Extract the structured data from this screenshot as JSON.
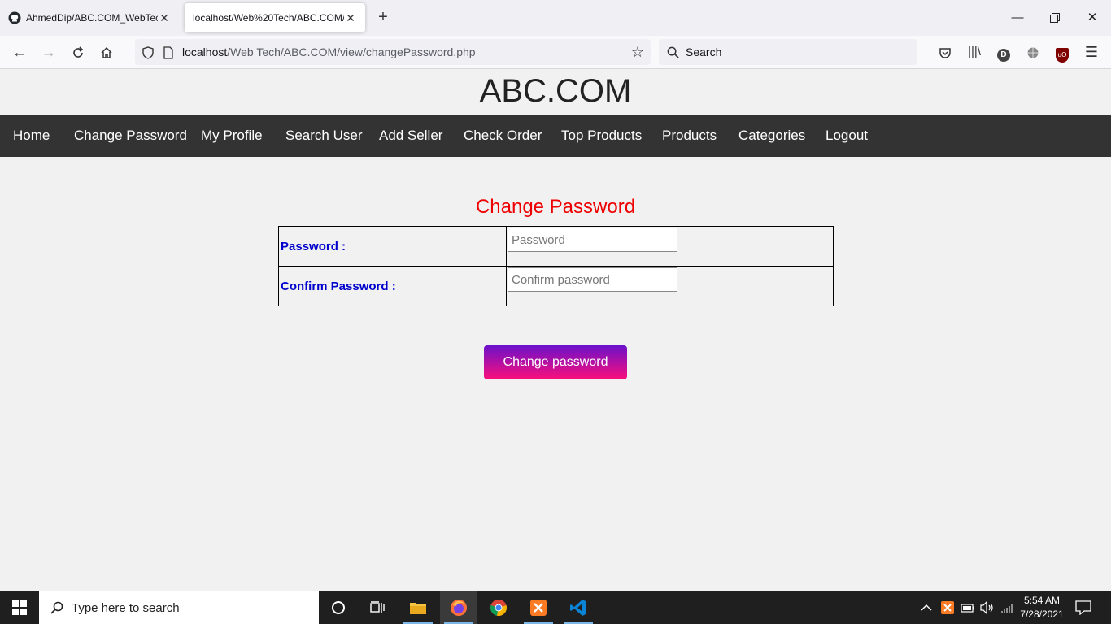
{
  "browser": {
    "tabs": [
      {
        "title": "AhmedDip/ABC.COM_WebTech",
        "active": false
      },
      {
        "title": "localhost/Web%20Tech/ABC.COM/",
        "active": true
      }
    ],
    "url_host": "localhost",
    "url_path": "/Web Tech/ABC.COM/view/changePassword.php",
    "search_placeholder": "Search",
    "profile_initial": "D",
    "ublock_label": "uO"
  },
  "site": {
    "title": "ABC.COM",
    "nav": [
      "Home",
      "Change Password",
      "My Profile",
      "Search User",
      "Add Seller",
      "Check Order",
      "Top Products",
      "Products",
      "Categories",
      "Logout"
    ]
  },
  "form": {
    "heading": "Change Password",
    "password_label": "Password :",
    "password_placeholder": "Password",
    "password_value": "",
    "confirm_label": "Confirm Password :",
    "confirm_placeholder": "Confirm password",
    "confirm_value": "",
    "submit_label": "Change password",
    "accent_color": "#ee0000",
    "label_color": "#0000cc"
  },
  "taskbar": {
    "search_placeholder": "Type here to search",
    "time": "5:54 AM",
    "date": "7/28/2021"
  }
}
